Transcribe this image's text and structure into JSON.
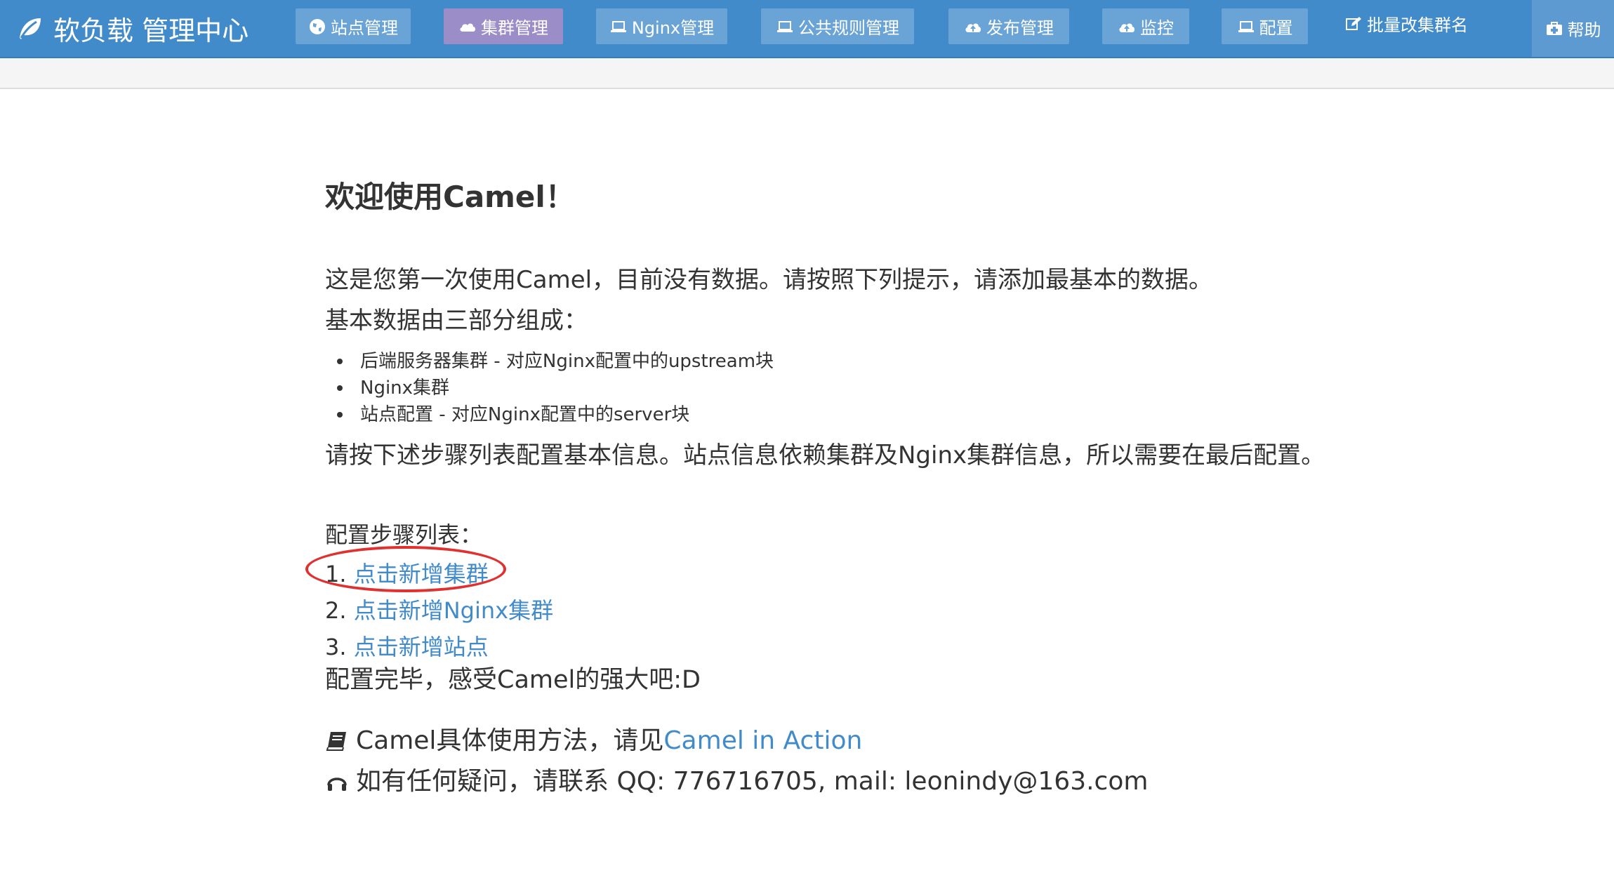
{
  "header": {
    "brand": "软负载 管理中心",
    "brand_icon": "leaf-icon",
    "nav": [
      {
        "label": "站点管理",
        "icon": "globe-icon"
      },
      {
        "label": "集群管理",
        "icon": "cloud-icon",
        "active": true
      },
      {
        "label": "Nginx管理",
        "icon": "laptop-icon"
      },
      {
        "label": "公共规则管理",
        "icon": "laptop-icon"
      },
      {
        "label": "发布管理",
        "icon": "cloud-upload-icon"
      },
      {
        "label": "监控",
        "icon": "cloud-upload-icon"
      },
      {
        "label": "配置",
        "icon": "laptop-icon"
      },
      {
        "label": "批量改集群名",
        "icon": "edit-icon"
      },
      {
        "label": "帮助",
        "icon": "medkit-icon"
      }
    ],
    "colors": {
      "bar": "#428bca",
      "button": "#6aa3d6",
      "active": "#9a8dc8"
    }
  },
  "content": {
    "title": "欢迎使用Camel！",
    "intro": "这是您第一次使用Camel，目前没有数据。请按照下列提示，请添加最基本的数据。",
    "composition": "基本数据由三部分组成：",
    "items": [
      "后端服务器集群 - 对应Nginx配置中的upstream块",
      "Nginx集群",
      "站点配置 - 对应Nginx配置中的server块"
    ],
    "steps_intro": "请按下述步骤列表配置基本信息。站点信息依赖集群及Nginx集群信息，所以需要在最后配置。",
    "steps_title": "配置步骤列表：",
    "steps": [
      {
        "num": "1.",
        "label": "点击新增集群"
      },
      {
        "num": "2.",
        "label": "点击新增Nginx集群"
      },
      {
        "num": "3.",
        "label": "点击新增站点"
      }
    ],
    "done": "配置完毕，感受Camel的强大吧:D",
    "usage_prefix": "Camel具体使用方法，请见",
    "usage_link": "Camel in Action",
    "usage_icon": "book-icon",
    "contact": "如有任何疑问，请联系 QQ: 776716705, mail: leonindy@163.com",
    "contact_icon": "headphones-icon",
    "link_color": "#428bca",
    "highlight_color": "#e03030"
  }
}
